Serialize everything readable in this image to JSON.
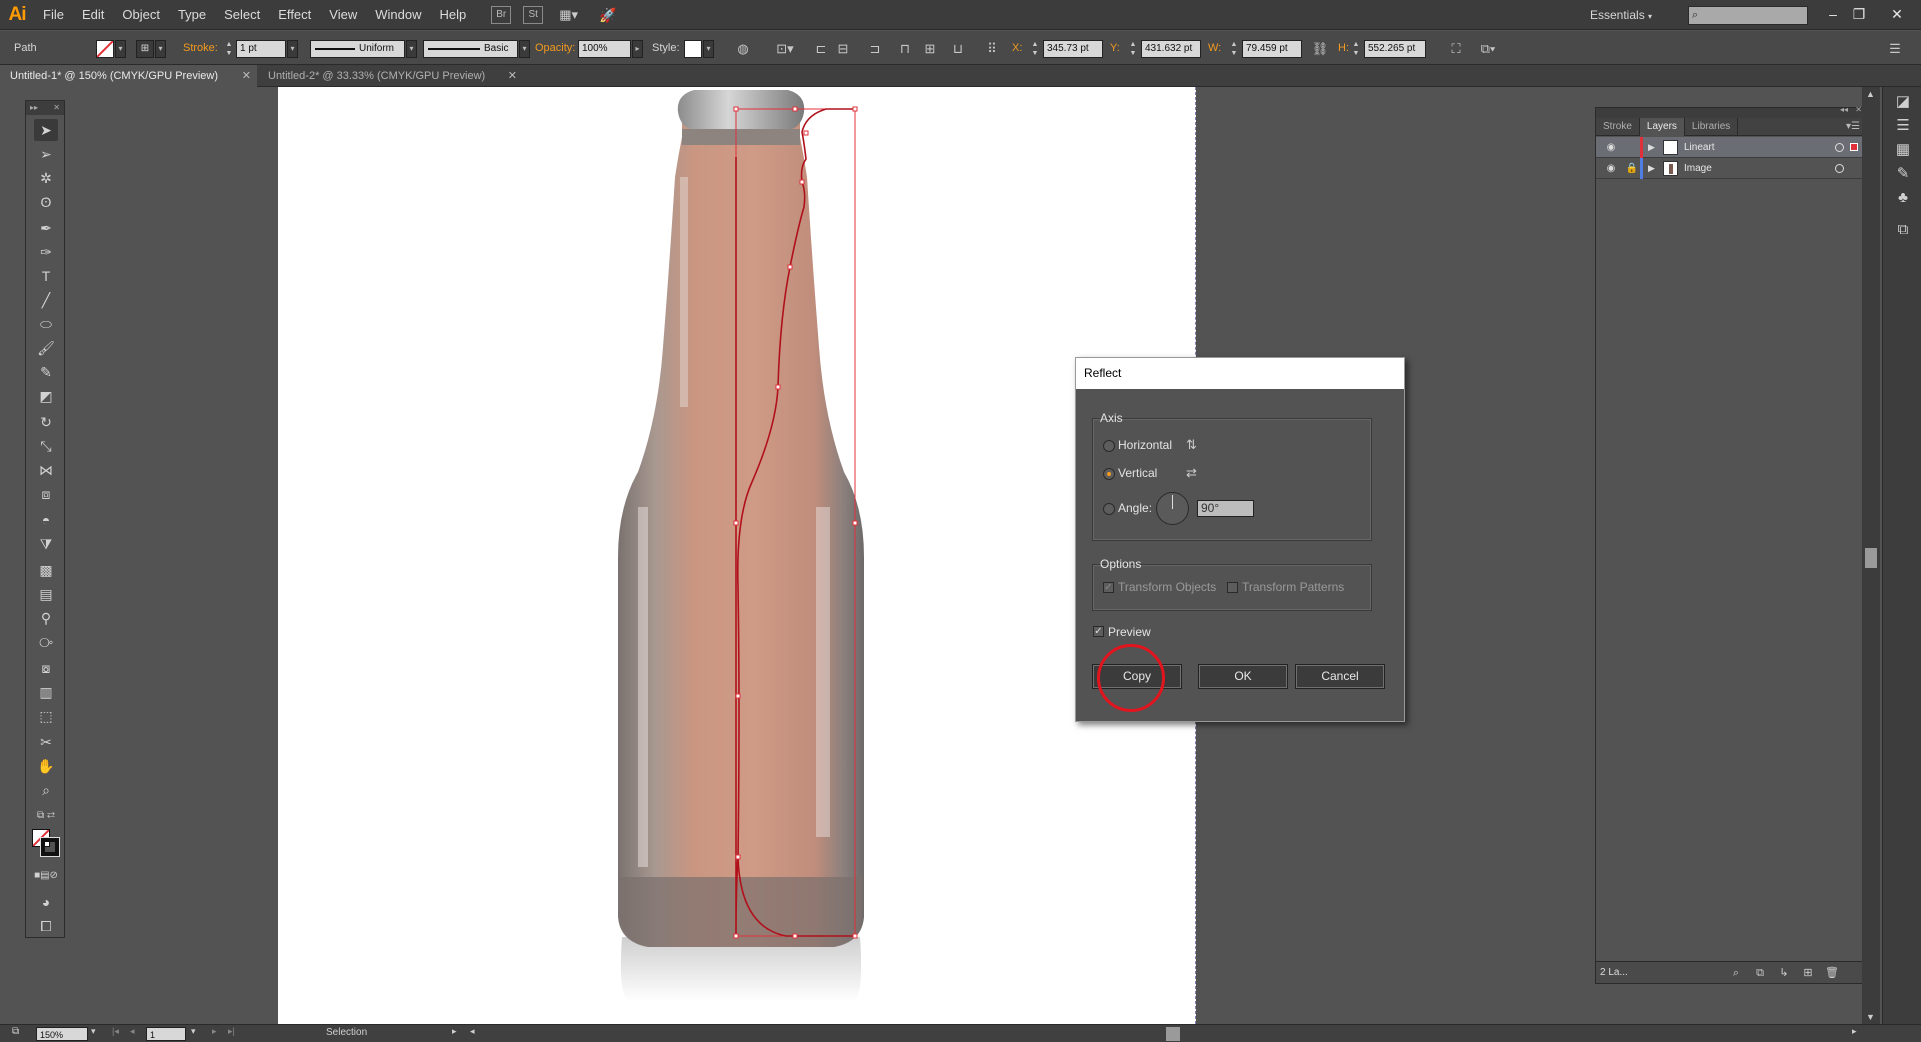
{
  "app": {
    "logo": "Ai"
  },
  "menubar": {
    "items": [
      "File",
      "Edit",
      "Object",
      "Type",
      "Select",
      "Effect",
      "View",
      "Window",
      "Help"
    ],
    "bridge_icon": "Br",
    "stock_icon": "St",
    "workspace": "Essentials",
    "window_controls": [
      "–",
      "❐",
      "✕"
    ]
  },
  "controlbar": {
    "selection_type": "Path",
    "stroke_label": "Stroke:",
    "stroke_weight": "1 pt",
    "profile": "Uniform",
    "brush": "Basic",
    "opacity_label": "Opacity:",
    "opacity_value": "100%",
    "style_label": "Style:",
    "x_label": "X:",
    "x_value": "345.73 pt",
    "y_label": "Y:",
    "y_value": "431.632 pt",
    "w_label": "W:",
    "w_value": "79.459 pt",
    "h_label": "H:",
    "h_value": "552.265 pt"
  },
  "tabs": [
    {
      "label": "Untitled-1* @ 150% (CMYK/GPU Preview)",
      "active": true
    },
    {
      "label": "Untitled-2* @ 33.33% (CMYK/GPU Preview)",
      "active": false
    }
  ],
  "layers_panel": {
    "tabs": [
      "Stroke",
      "Layers",
      "Libraries"
    ],
    "active_tab": "Layers",
    "layers": [
      {
        "name": "Lineart",
        "selected": true,
        "locked": false,
        "color": "#e0303a"
      },
      {
        "name": "Image",
        "selected": false,
        "locked": true,
        "color": "#4f7de0"
      }
    ],
    "footer_count": "2 La..."
  },
  "reflect_dialog": {
    "title": "Reflect",
    "axis_label": "Axis",
    "horizontal_label": "Horizontal",
    "vertical_label": "Vertical",
    "angle_label": "Angle:",
    "angle_value": "90°",
    "selected_axis": "vertical",
    "options_label": "Options",
    "transform_objects_label": "Transform Objects",
    "transform_patterns_label": "Transform Patterns",
    "preview_label": "Preview",
    "preview_checked": true,
    "buttons": {
      "copy": "Copy",
      "ok": "OK",
      "cancel": "Cancel"
    }
  },
  "statusbar": {
    "zoom": "150%",
    "page": "1",
    "tool": "Selection"
  },
  "colors": {
    "accent": "#f39a1f",
    "path_selection": "#e0303a",
    "highlight_circle": "#e2141e"
  }
}
